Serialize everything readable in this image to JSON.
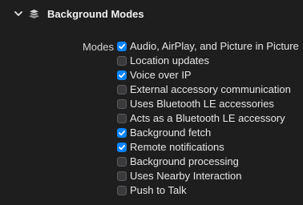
{
  "section": {
    "title": "Background Modes",
    "expanded": true,
    "icon": "layers-icon"
  },
  "modes": {
    "label": "Modes",
    "options": [
      {
        "label": "Audio, AirPlay, and Picture in Picture",
        "checked": true
      },
      {
        "label": "Location updates",
        "checked": false
      },
      {
        "label": "Voice over IP",
        "checked": true
      },
      {
        "label": "External accessory communication",
        "checked": false
      },
      {
        "label": "Uses Bluetooth LE accessories",
        "checked": false
      },
      {
        "label": "Acts as a Bluetooth LE accessory",
        "checked": false
      },
      {
        "label": "Background fetch",
        "checked": true
      },
      {
        "label": "Remote notifications",
        "checked": true
      },
      {
        "label": "Background processing",
        "checked": false
      },
      {
        "label": "Uses Nearby Interaction",
        "checked": false
      },
      {
        "label": "Push to Talk",
        "checked": false
      }
    ]
  },
  "colors": {
    "background": "#1e1e1e",
    "accent": "#0a84ff"
  }
}
